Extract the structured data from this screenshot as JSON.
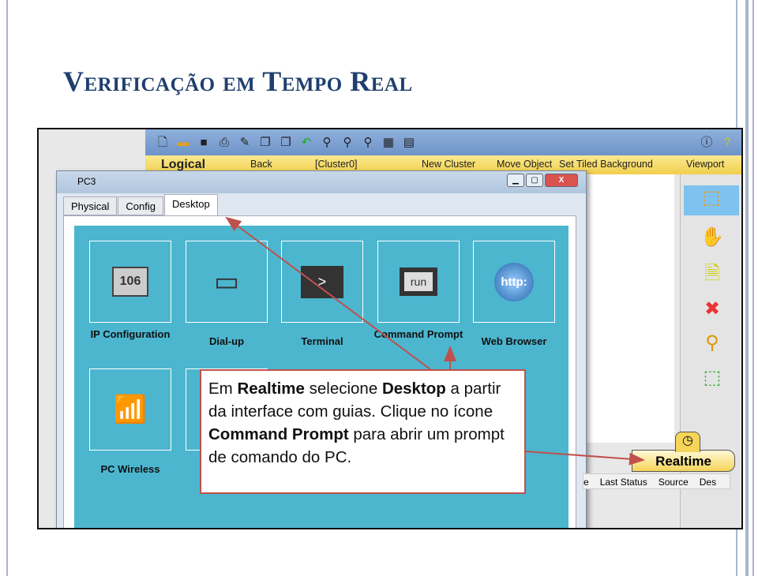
{
  "slide": {
    "title": "Verificação em Tempo Real"
  },
  "toolbar": {
    "icons": [
      "new-icon",
      "open-icon",
      "save-icon",
      "print-icon",
      "edit-icon",
      "copy-icon",
      "paste-icon",
      "undo-icon",
      "zoom-in-icon",
      "zoom-reset-icon",
      "zoom-out-icon",
      "palette-icon",
      "device-icon",
      "info-icon",
      "help-icon"
    ]
  },
  "workspace_bar": {
    "logical": "Logical",
    "back": "Back",
    "cluster": "[Cluster0]",
    "new_cluster": "New Cluster",
    "move_object": "Move Object",
    "tiled_bg": "Set Tiled Background",
    "viewport": "Viewport"
  },
  "window": {
    "title": "PC3",
    "tabs": [
      "Physical",
      "Config",
      "Desktop"
    ],
    "active_tab": "Desktop",
    "apps": [
      {
        "label": "IP Configuration",
        "icon": "ip-config-icon"
      },
      {
        "label": "Dial-up",
        "icon": "modem-icon"
      },
      {
        "label": "Terminal",
        "icon": "terminal-icon"
      },
      {
        "label": "Command Prompt",
        "icon": "command-prompt-icon"
      },
      {
        "label": "Web Browser",
        "icon": "web-browser-icon"
      },
      {
        "label": "PC Wireless",
        "icon": "wireless-icon"
      }
    ],
    "ip_tile_text": "106",
    "terminal_text": ">",
    "run_text": "run",
    "http_text": "http:"
  },
  "mode": {
    "realtime": "Realtime"
  },
  "pdu_table": {
    "columns": [
      "e",
      "Last Status",
      "Source",
      "Des"
    ]
  },
  "callout": {
    "p1": "Em ",
    "b1": "Realtime",
    "p2": " selecione ",
    "b2": "Desktop",
    "p3": " a partir da interface com guias. Clique no ícone ",
    "b3": "Command Prompt",
    "p4": " para abrir um prompt de comando do PC."
  },
  "colors": {
    "title": "#1f3f6e",
    "desktop_bg": "#4cb6cf",
    "callout_border": "#c0504d",
    "arrow": "#c0504d"
  }
}
